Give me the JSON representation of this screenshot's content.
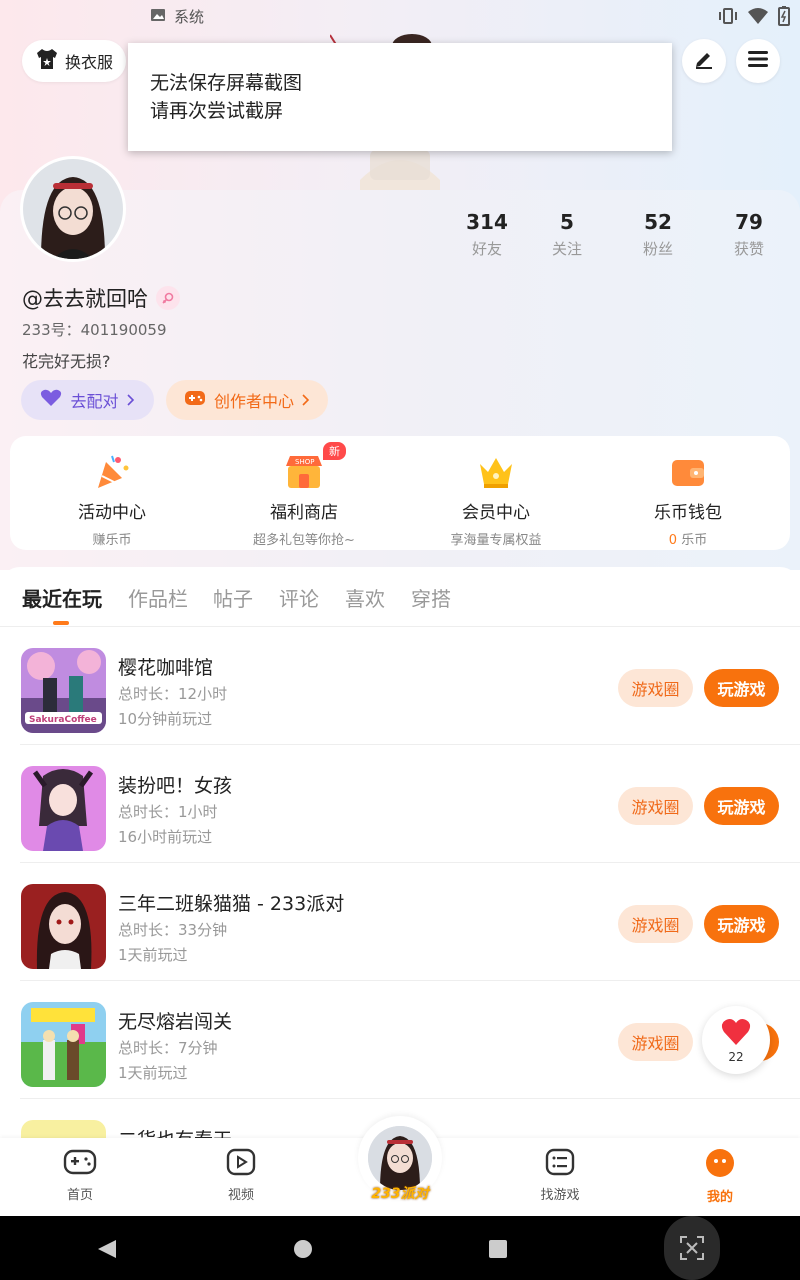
{
  "status_bar": {
    "app_label": "系统"
  },
  "header": {
    "outfit_label": "换衣服"
  },
  "toast": {
    "line1": "无法保存屏幕截图",
    "line2": "请再次尝试截屏"
  },
  "profile": {
    "stats": [
      {
        "value": "314",
        "label": "好友"
      },
      {
        "value": "5",
        "label": "关注"
      },
      {
        "value": "52",
        "label": "粉丝"
      },
      {
        "value": "79",
        "label": "获赞"
      }
    ],
    "username": "@去去就回哈",
    "uid": "233号：401190059",
    "bio": "花完好无损?",
    "pair_label": "去配对",
    "creator_label": "创作者中心"
  },
  "quick_menu": [
    {
      "title": "活动中心",
      "subtitle": "赚乐币"
    },
    {
      "title": "福利商店",
      "subtitle": "超多礼包等你抢~",
      "badge": "新"
    },
    {
      "title": "会员中心",
      "subtitle": "享海量专属权益"
    },
    {
      "title": "乐币钱包",
      "subtitle_value": "0",
      "subtitle": "乐币"
    }
  ],
  "tabs": [
    "最近在玩",
    "作品栏",
    "帖子",
    "评论",
    "喜欢",
    "穿搭"
  ],
  "games": [
    {
      "name": "樱花咖啡馆",
      "duration": "总时长：12小时",
      "last_played": "10分钟前玩过"
    },
    {
      "name": "装扮吧！女孩",
      "duration": "总时长：1小时",
      "last_played": "16小时前玩过"
    },
    {
      "name": "三年二班躲猫猫 - 233派对",
      "duration": "总时长：33分钟",
      "last_played": "1天前玩过"
    },
    {
      "name": "无尽熔岩闯关",
      "duration": "总时长：7分钟",
      "last_played": "1天前玩过"
    },
    {
      "name": "二货也有春天",
      "duration": "",
      "last_played": ""
    }
  ],
  "game_actions": {
    "circle_label": "游戏圈",
    "play_label": "玩游戏"
  },
  "like_bubble": {
    "count": "22"
  },
  "bottom_nav": {
    "home": "首页",
    "video": "视频",
    "center": "233派对",
    "find": "找游戏",
    "me": "我的"
  },
  "colors": {
    "accent": "#f8720d",
    "accent_light": "#fde6d6",
    "purple": "#6a4fd6"
  }
}
